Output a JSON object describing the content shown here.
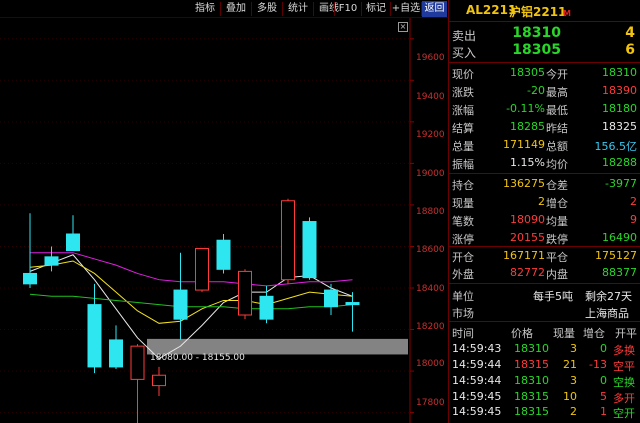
{
  "toolbar": {
    "buttons": [
      {
        "label": "指标"
      },
      {
        "label": "叠加"
      },
      {
        "label": "多股"
      },
      {
        "label": "统计"
      },
      {
        "label": "画线"
      },
      {
        "label": "F10"
      },
      {
        "label": "标记"
      },
      {
        "label": "+自选"
      },
      {
        "label": "返回"
      }
    ],
    "active_index": 8
  },
  "chart": {
    "y_ticks": [
      "19600",
      "19400",
      "19200",
      "19000",
      "18800",
      "18600",
      "18400",
      "18200",
      "18000",
      "17800"
    ],
    "range_label": "18080.00 - 18155.00",
    "corner_glyph": "×"
  },
  "chart_data": {
    "type": "candlestick",
    "ylim": [
      17750,
      19700
    ],
    "candles": [
      {
        "o": 18470,
        "h": 18760,
        "l": 18400,
        "c": 18420
      },
      {
        "o": 18550,
        "h": 18600,
        "l": 18480,
        "c": 18510
      },
      {
        "o": 18660,
        "h": 18750,
        "l": 18580,
        "c": 18580
      },
      {
        "o": 18320,
        "h": 18420,
        "l": 17990,
        "c": 18020
      },
      {
        "o": 18150,
        "h": 18220,
        "l": 18010,
        "c": 18020
      },
      {
        "o": 17960,
        "h": 18130,
        "l": 17750,
        "c": 18120
      },
      {
        "o": 17930,
        "h": 18020,
        "l": 17880,
        "c": 17980
      },
      {
        "o": 18390,
        "h": 18570,
        "l": 18150,
        "c": 18250
      },
      {
        "o": 18390,
        "h": 18590,
        "l": 18380,
        "c": 18590
      },
      {
        "o": 18630,
        "h": 18660,
        "l": 18470,
        "c": 18490
      },
      {
        "o": 18270,
        "h": 18490,
        "l": 18250,
        "c": 18480
      },
      {
        "o": 18360,
        "h": 18410,
        "l": 18230,
        "c": 18250
      },
      {
        "o": 18440,
        "h": 18830,
        "l": 18420,
        "c": 18820
      },
      {
        "o": 18720,
        "h": 18740,
        "l": 18440,
        "c": 18450
      },
      {
        "o": 18390,
        "h": 18420,
        "l": 18270,
        "c": 18310
      },
      {
        "o": 18330,
        "h": 18380,
        "l": 18190,
        "c": 18320
      }
    ],
    "moving_averages": [
      {
        "color": "#e8e8e8",
        "values": [
          18480,
          18520,
          18560,
          18440,
          18300,
          18160,
          18060,
          18120,
          18220,
          18330,
          18380,
          18380,
          18450,
          18460,
          18400,
          18360
        ]
      },
      {
        "color": "#f1e020",
        "values": [
          18500,
          18510,
          18530,
          18470,
          18380,
          18290,
          18230,
          18240,
          18300,
          18340,
          18340,
          18320,
          18350,
          18380,
          18370,
          18360
        ]
      },
      {
        "color": "#e020e0",
        "values": [
          18570,
          18570,
          18570,
          18540,
          18510,
          18470,
          18440,
          18430,
          18430,
          18430,
          18420,
          18410,
          18420,
          18430,
          18430,
          18440
        ]
      },
      {
        "color": "#20c020",
        "values": [
          18370,
          18360,
          18360,
          18350,
          18340,
          18330,
          18320,
          18310,
          18310,
          18310,
          18300,
          18300,
          18300,
          18310,
          18310,
          18320
        ]
      }
    ]
  },
  "quote": {
    "code": "AL2211",
    "name": "沪铝2211",
    "badge": "M",
    "sell_label": "卖出",
    "sell_price": "18310",
    "sell_vol": "4",
    "buy_label": "买入",
    "buy_price": "18305",
    "buy_vol": "6",
    "rows1": [
      {
        "l1": "现价",
        "v1": "18305",
        "l2": "今开",
        "v2": "18310"
      },
      {
        "l1": "涨跌",
        "v1": "-20",
        "l2": "最高",
        "v2": "18390"
      },
      {
        "l1": "涨幅",
        "v1": "-0.11%",
        "l2": "最低",
        "v2": "18180"
      },
      {
        "l1": "结算",
        "v1": "18285",
        "l2": "昨结",
        "v2": "18325"
      },
      {
        "l1": "总量",
        "v1": "171149",
        "l2": "总额",
        "v2": "156.5亿"
      },
      {
        "l1": "振幅",
        "v1": "1.15%",
        "l2": "均价",
        "v2": "18288"
      }
    ],
    "rows2": [
      {
        "l1": "持仓",
        "v1": "136275",
        "l2": "仓差",
        "v2": "-3977"
      },
      {
        "l1": "现量",
        "v1": "2",
        "l2": "增仓",
        "v2": "2"
      },
      {
        "l1": "笔数",
        "v1": "18090",
        "l2": "均量",
        "v2": "9"
      },
      {
        "l1": "涨停",
        "v1": "20155",
        "l2": "跌停",
        "v2": "16490"
      }
    ],
    "rows3": [
      {
        "l1": "开仓",
        "v1": "167171",
        "l2": "平仓",
        "v2": "175127"
      },
      {
        "l1": "外盘",
        "v1": "82772",
        "l2": "内盘",
        "v2": "88377"
      }
    ],
    "unit_label": "单位",
    "unit_value": "每手5吨",
    "remain_value": "剩余27天",
    "market_label": "市场",
    "market_value": "上海商品"
  },
  "trades": {
    "headers": [
      "时间",
      "价格",
      "现量",
      "增仓",
      "开平"
    ],
    "rows": [
      {
        "time": "14:59:43",
        "price": "18310",
        "vol": "3",
        "oi": "0",
        "type": "多换"
      },
      {
        "time": "14:59:44",
        "price": "18315",
        "vol": "21",
        "oi": "-13",
        "type": "空平"
      },
      {
        "time": "14:59:44",
        "price": "18310",
        "vol": "3",
        "oi": "0",
        "type": "空换"
      },
      {
        "time": "14:59:45",
        "price": "18315",
        "vol": "10",
        "oi": "5",
        "type": "多开"
      },
      {
        "time": "14:59:45",
        "price": "18315",
        "vol": "2",
        "oi": "1",
        "type": "空开"
      }
    ]
  }
}
